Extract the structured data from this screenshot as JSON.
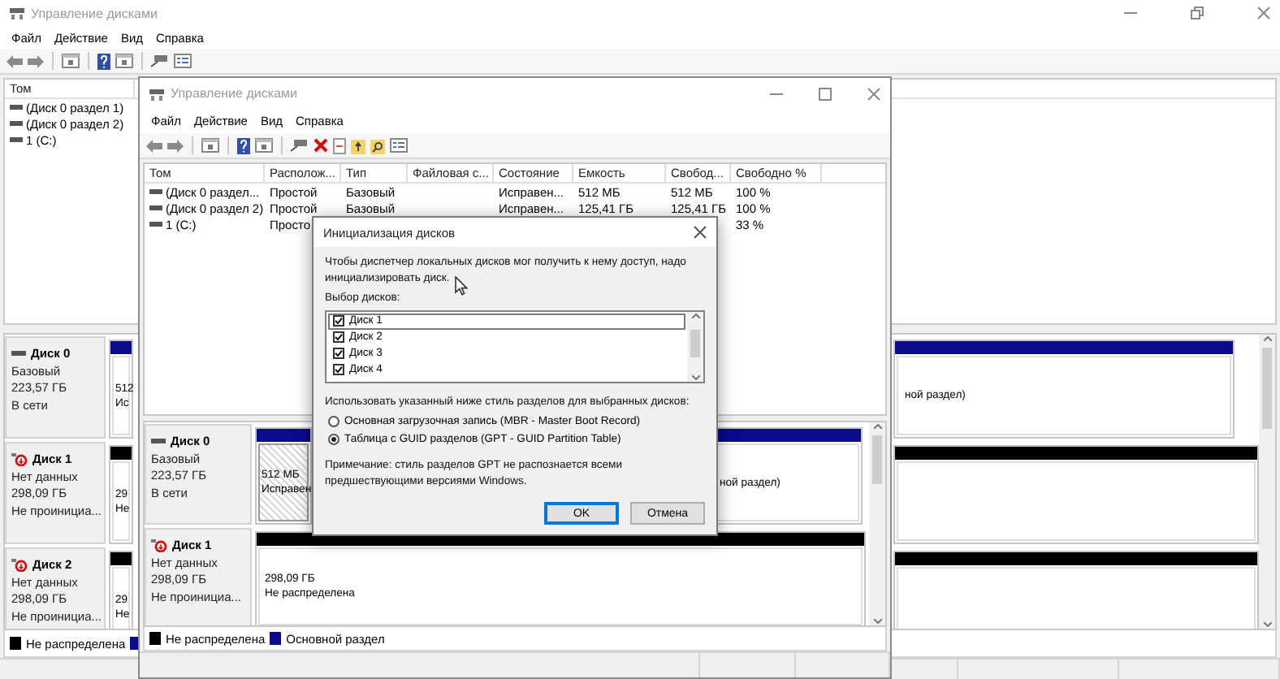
{
  "back_window": {
    "title": "Управление дисками",
    "menu": [
      "Файл",
      "Действие",
      "Вид",
      "Справка"
    ],
    "volume_columns": [
      "Том"
    ],
    "volumes": [
      {
        "cells": [
          "(Диск 0 раздел 1)"
        ]
      },
      {
        "cells": [
          "(Диск 0 раздел 2)"
        ]
      },
      {
        "cells": [
          "1 (C:)"
        ]
      }
    ],
    "disks": [
      {
        "name": "Диск 0",
        "kind": "online",
        "lines": [
          "Базовый",
          "223,57 ГБ",
          "В сети"
        ],
        "partitions": [
          {
            "kind": "primary",
            "selected": false,
            "lines": [
              "512",
              "Ис"
            ]
          },
          {
            "kind": "primary",
            "selected": false,
            "lines": [
              "ной раздел)"
            ]
          }
        ]
      },
      {
        "name": "Диск 1",
        "kind": "uninitialized",
        "lines": [
          "Нет данных",
          "298,09 ГБ",
          "Не проинициа..."
        ],
        "partitions": [
          {
            "kind": "unallocated",
            "selected": false,
            "lines": [
              "29",
              "Не"
            ]
          }
        ]
      },
      {
        "name": "Диск 2",
        "kind": "uninitialized",
        "lines": [
          "Нет данных",
          "298,09 ГБ",
          "Не проинициа..."
        ],
        "partitions": [
          {
            "kind": "unallocated",
            "selected": false,
            "lines": [
              "29",
              "Не"
            ]
          }
        ]
      }
    ],
    "legend": [
      {
        "label": "Не распределена",
        "color": "#000000"
      },
      {
        "color": "#0a0a8c"
      }
    ]
  },
  "front_window": {
    "title": "Управление дисками",
    "menu": [
      "Файл",
      "Действие",
      "Вид",
      "Справка"
    ],
    "volume_columns": [
      "Том",
      "Располож...",
      "Тип",
      "Файловая с...",
      "Состояние",
      "Емкость",
      "Свобод...",
      "Свободно %"
    ],
    "volumes": [
      {
        "cells": [
          "(Диск 0 раздел...",
          "Простой",
          "Базовый",
          null,
          "Исправен...",
          "512 МБ",
          "512 МБ",
          "100 %"
        ]
      },
      {
        "cells": [
          "(Диск 0 раздел 2)",
          "Простой",
          "Базовый",
          null,
          "Исправен...",
          "125,41 ГБ",
          "125,41 ГБ",
          "100 %"
        ]
      },
      {
        "cells": [
          "1 (C:)",
          "Просто",
          null,
          null,
          null,
          null,
          null,
          "33 %"
        ]
      }
    ],
    "disks": [
      {
        "name": "Диск 0",
        "kind": "online",
        "lines": [
          "Базовый",
          "223,57 ГБ",
          "В сети"
        ],
        "partitions": [
          {
            "kind": "primary",
            "selected": true,
            "lines": [
              "512 МБ",
              "Исправен"
            ]
          },
          {
            "kind": "primary",
            "selected": false,
            "lines": [
              "ной раздел)"
            ]
          }
        ]
      },
      {
        "name": "Диск 1",
        "kind": "uninitialized",
        "lines": [
          "Нет данных",
          "298,09 ГБ",
          "Не проинициа..."
        ],
        "partitions": [
          {
            "kind": "unallocated",
            "selected": false,
            "lines": [
              "298,09 ГБ",
              "Не распределена"
            ]
          }
        ]
      }
    ],
    "legend": [
      {
        "label": "Не распределена",
        "color": "#000000"
      },
      {
        "label": "Основной раздел",
        "color": "#0a0a8c"
      }
    ]
  },
  "dialog": {
    "title": "Инициализация дисков",
    "intro": "Чтобы диспетчер локальных дисков мог получить к нему доступ, надо инициализировать диск.",
    "list_label": "Выбор дисков:",
    "disks": [
      {
        "label": "Диск 1",
        "checked": true,
        "selected": true
      },
      {
        "label": "Диск 2",
        "checked": true,
        "selected": false
      },
      {
        "label": "Диск 3",
        "checked": true,
        "selected": false
      },
      {
        "label": "Диск 4",
        "checked": true,
        "selected": false
      }
    ],
    "style_label": "Использовать указанный ниже стиль разделов для выбранных дисков:",
    "styles": [
      {
        "label": "Основная загрузочная запись (MBR - Master Boot Record)",
        "selected": false
      },
      {
        "label": "Таблица с GUID разделов (GPT - GUID Partition Table)",
        "selected": true
      }
    ],
    "note": "Примечание: стиль разделов GPT не распознается всеми предшествующими версиями Windows.",
    "buttons": [
      {
        "label": "OK",
        "default": true
      },
      {
        "label": "Отмена",
        "default": false
      }
    ]
  }
}
